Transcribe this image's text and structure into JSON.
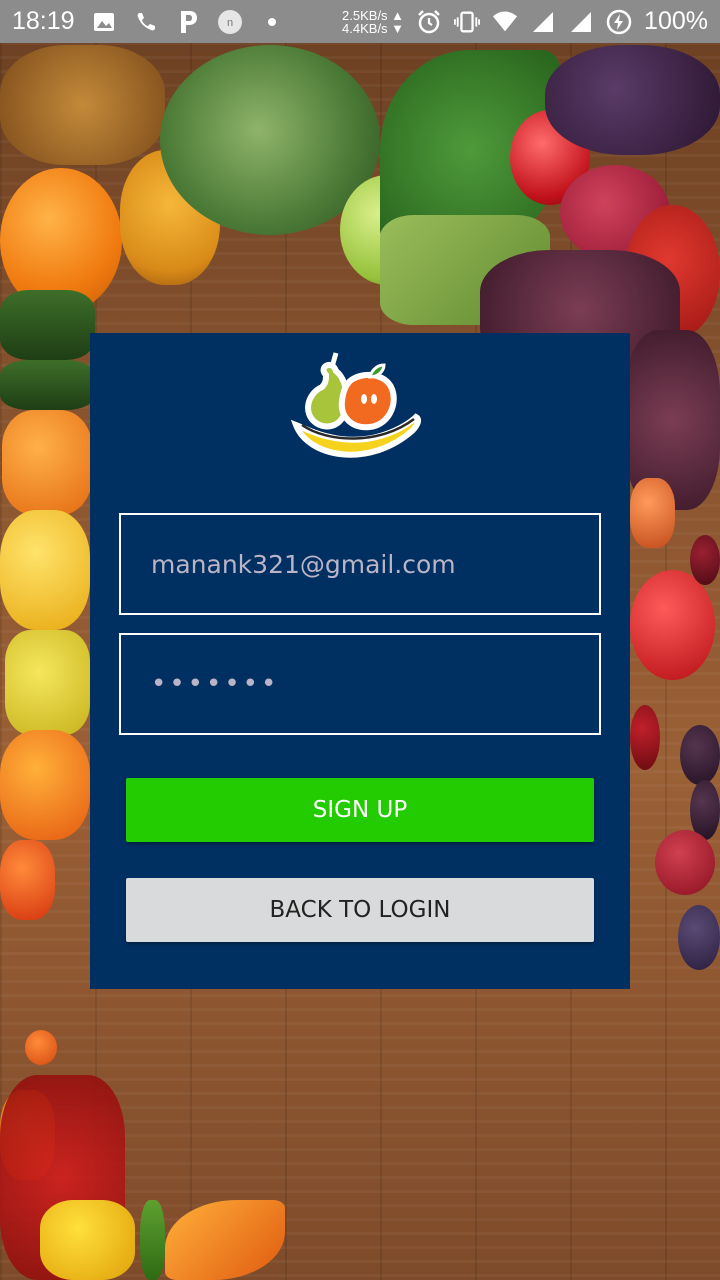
{
  "status_bar": {
    "time": "18:19",
    "notification_icons": [
      "image-icon",
      "phone-icon",
      "p-app-icon",
      "n-app-icon",
      "dot-icon"
    ],
    "net_up": "2.5KB/s",
    "net_down": "4.4KB/s",
    "battery": "100%"
  },
  "signup_form": {
    "email_value": "manank321@gmail.com",
    "password_value": "•••••••",
    "signup_label": "SIGN UP",
    "back_label": "BACK TO LOGIN"
  },
  "colors": {
    "card": "#002f62",
    "signup_button": "#22cc00",
    "back_button": "#d9dadb",
    "status_bar": "#8c8c8c"
  }
}
